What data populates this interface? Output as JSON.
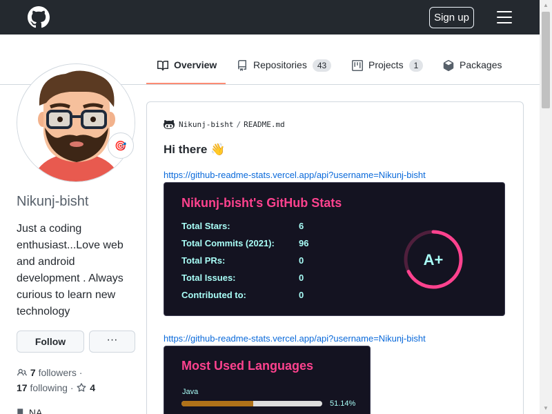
{
  "header": {
    "signup_label": "Sign up"
  },
  "tabs": [
    {
      "label": "Overview",
      "icon": "book-icon",
      "active": true
    },
    {
      "label": "Repositories",
      "icon": "repo-icon",
      "count": "43"
    },
    {
      "label": "Projects",
      "icon": "project-icon",
      "count": "1"
    },
    {
      "label": "Packages",
      "icon": "package-icon"
    }
  ],
  "profile": {
    "username": "Nikunj-bisht",
    "bio": "Just a coding enthusiast...Love web and android development . Always curious to learn new technology",
    "follow_label": "Follow",
    "more_label": "···",
    "followers_count": "7",
    "followers_label": "followers",
    "following_count": "17",
    "following_label": "following",
    "stars_count": "4",
    "location": "NA",
    "status_emoji": "🎯"
  },
  "readme": {
    "owner": "Nikunj-bisht",
    "file": "README.md",
    "greeting": "Hi there 👋",
    "link1": "https://github-readme-stats.vercel.app/api?username=Nikunj-bisht",
    "link2": "https://github-readme-stats.vercel.app/api?username=Nikunj-bisht"
  },
  "stats_card": {
    "title": "Nikunj-bisht's GitHub Stats",
    "rows": [
      {
        "label": "Total Stars:",
        "value": "6"
      },
      {
        "label": "Total Commits (2021):",
        "value": "96"
      },
      {
        "label": "Total PRs:",
        "value": "0"
      },
      {
        "label": "Total Issues:",
        "value": "0"
      },
      {
        "label": "Contributed to:",
        "value": "0"
      }
    ],
    "grade": "A+",
    "colors": {
      "bg": "#141321",
      "title": "#fe428e",
      "text": "#a9fef7",
      "ring": "#fe428e"
    }
  },
  "lang_card": {
    "title": "Most Used Languages",
    "languages": [
      {
        "name": "Java",
        "percent_label": "51.14%",
        "fraction": 0.5114,
        "color": "#b07219"
      }
    ]
  }
}
